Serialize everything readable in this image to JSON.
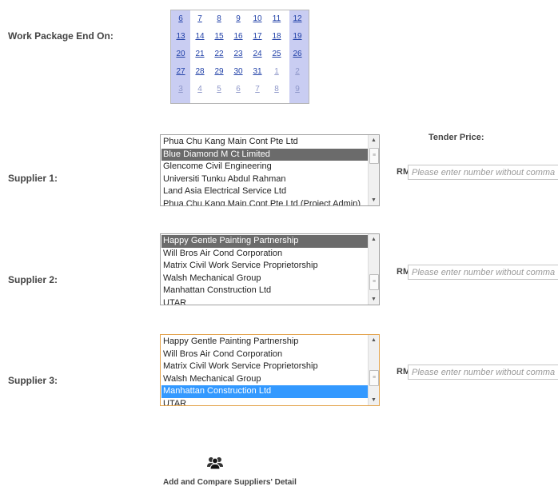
{
  "work_package": {
    "end_label": "Work Package End On:",
    "calendar_weeks": [
      [
        {
          "d": "6",
          "o": false
        },
        {
          "d": "7",
          "o": false
        },
        {
          "d": "8",
          "o": false
        },
        {
          "d": "9",
          "o": false
        },
        {
          "d": "10",
          "o": false
        },
        {
          "d": "11",
          "o": false
        },
        {
          "d": "12",
          "o": false
        }
      ],
      [
        {
          "d": "13",
          "o": false
        },
        {
          "d": "14",
          "o": false
        },
        {
          "d": "15",
          "o": false
        },
        {
          "d": "16",
          "o": false
        },
        {
          "d": "17",
          "o": false
        },
        {
          "d": "18",
          "o": false
        },
        {
          "d": "19",
          "o": false
        }
      ],
      [
        {
          "d": "20",
          "o": false
        },
        {
          "d": "21",
          "o": false
        },
        {
          "d": "22",
          "o": false
        },
        {
          "d": "23",
          "o": false
        },
        {
          "d": "24",
          "o": false
        },
        {
          "d": "25",
          "o": false
        },
        {
          "d": "26",
          "o": false
        }
      ],
      [
        {
          "d": "27",
          "o": false
        },
        {
          "d": "28",
          "o": false
        },
        {
          "d": "29",
          "o": false
        },
        {
          "d": "30",
          "o": false
        },
        {
          "d": "31",
          "o": false
        },
        {
          "d": "1",
          "o": true
        },
        {
          "d": "2",
          "o": true
        }
      ],
      [
        {
          "d": "3",
          "o": true
        },
        {
          "d": "4",
          "o": true
        },
        {
          "d": "5",
          "o": true
        },
        {
          "d": "6",
          "o": true
        },
        {
          "d": "7",
          "o": true
        },
        {
          "d": "8",
          "o": true
        },
        {
          "d": "9",
          "o": true
        }
      ]
    ]
  },
  "tender_price_heading": "Tender Price:",
  "currency": "RM",
  "price_placeholder": "Please enter number without comma",
  "suppliers": [
    {
      "label": "Supplier 1:",
      "options": [
        "Phua Chu Kang Main Cont Pte Ltd",
        "Blue Diamond M Ct Limited",
        "Glencome Civil Engineering",
        "Universiti Tunku Abdul Rahman",
        "Land Asia Electrical Service Ltd",
        "Phua Chu Kang Main Cont Pte Ltd (Project Admin)"
      ],
      "selected_index": 1,
      "selected_style": "gray"
    },
    {
      "label": "Supplier 2:",
      "options": [
        "Happy Gentle Painting Partnership",
        "Will Bros Air Cond Corporation",
        "Matrix Civil Work Service Proprietorship",
        "Walsh Mechanical Group",
        "Manhattan Construction Ltd",
        "UTAR"
      ],
      "selected_index": 0,
      "selected_style": "gray"
    },
    {
      "label": "Supplier 3:",
      "options": [
        "Happy Gentle Painting Partnership",
        "Will Bros Air Cond Corporation",
        "Matrix Civil Work Service Proprietorship",
        "Walsh Mechanical Group",
        "Manhattan Construction Ltd",
        "UTAR"
      ],
      "selected_index": 4,
      "selected_style": "blue"
    }
  ],
  "actions": {
    "add_compare_label": "Add and Compare Suppliers' Detail",
    "add_compare_icon": "users-group-icon"
  },
  "colors": {
    "calendar_weekend": "#c9cdf2",
    "date_link": "#1f3fa7",
    "selected_gray": "#6b6b6b",
    "selected_blue": "#3399ff",
    "focus_border": "#e3a34c"
  }
}
